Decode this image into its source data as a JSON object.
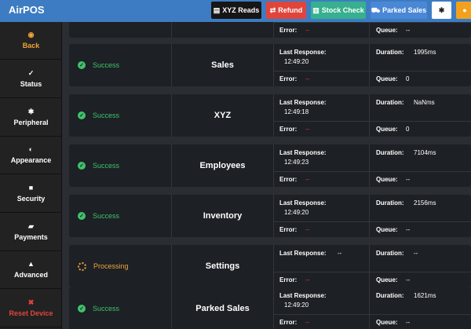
{
  "app": {
    "title": "AirPOS"
  },
  "toolbar": {
    "reads": "XYZ Reads",
    "refund": "Refund",
    "stock": "Stock Check",
    "parked": "Parked Sales"
  },
  "sidebar": {
    "items": [
      {
        "label": "Back"
      },
      {
        "label": "Status"
      },
      {
        "label": "Peripheral"
      },
      {
        "label": "Appearance"
      },
      {
        "label": "Security"
      },
      {
        "label": "Payments"
      },
      {
        "label": "Advanced"
      },
      {
        "label": "Reset Device"
      }
    ]
  },
  "labels": {
    "last_response": "Last Response:",
    "duration": "Duration:",
    "error": "Error:",
    "queue": "Queue:"
  },
  "partial": {
    "error": "--",
    "queue": "--"
  },
  "cards": [
    {
      "status": "Success",
      "name": "Sales",
      "last_response": "12:49:20",
      "duration": "1995ms",
      "error": "--",
      "queue": "0"
    },
    {
      "status": "Success",
      "name": "XYZ",
      "last_response": "12:49:18",
      "duration": "NaNms",
      "error": "--",
      "queue": "0"
    },
    {
      "status": "Success",
      "name": "Employees",
      "last_response": "12:49:23",
      "duration": "7104ms",
      "error": "--",
      "queue": "--"
    },
    {
      "status": "Success",
      "name": "Inventory",
      "last_response": "12:49:20",
      "duration": "2156ms",
      "error": "--",
      "queue": "--"
    },
    {
      "status": "Processing",
      "name": "Settings",
      "last_response": "--",
      "duration": "--",
      "error": "--",
      "queue": "--"
    },
    {
      "status": "Success",
      "name": "Parked Sales",
      "last_response": "12:49:20",
      "duration": "1621ms",
      "error": "--",
      "queue": "--"
    }
  ]
}
